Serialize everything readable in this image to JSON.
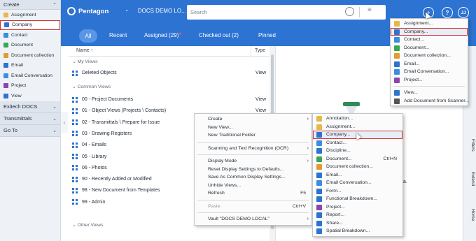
{
  "nav": {
    "create_label": "Create",
    "items": [
      {
        "label": "Assignment",
        "color": "#e6b84a"
      },
      {
        "label": "Company",
        "color": "#2d73d2"
      },
      {
        "label": "Contact",
        "color": "#3b8de0"
      },
      {
        "label": "Document",
        "color": "#36a852"
      },
      {
        "label": "Document collection",
        "color": "#e39b2d"
      },
      {
        "label": "Email",
        "color": "#2d73d2"
      },
      {
        "label": "Email Conversation",
        "color": "#3b8de0"
      },
      {
        "label": "Project",
        "color": "#8e44ad"
      },
      {
        "label": "View",
        "color": "#2d73d2"
      }
    ],
    "sections": [
      "Exitech DOCS",
      "Transmittals",
      "Go To"
    ]
  },
  "topbar": {
    "app_name": "Pentagon",
    "vault_name": "DOCS DEMO LO...",
    "search_placeholder": "Search",
    "help_glyph": "?",
    "user_glyph": "JJ"
  },
  "tabs": [
    "All",
    "Recent",
    "Assigned (29)",
    "Checked out (2)",
    "Pinned"
  ],
  "list": {
    "col_name": "Name",
    "col_type": "Type",
    "groups": [
      "My Views",
      "Common Views",
      "Other Views"
    ],
    "my_views": [
      {
        "name": "Deleted Objects",
        "type": "View"
      }
    ],
    "common_views": [
      {
        "name": "00 - Project Documents",
        "type": "View"
      },
      {
        "name": "01 - Object Views (Projects \\ Contacts)",
        "type": "View"
      },
      {
        "name": "02 - Transmittals \\ Prepare for Issue",
        "type": ""
      },
      {
        "name": "03 - Drawing Registers",
        "type": ""
      },
      {
        "name": "04 - Emails",
        "type": ""
      },
      {
        "name": "05 - Library",
        "type": ""
      },
      {
        "name": "06 - Photos",
        "type": ""
      },
      {
        "name": "90 - Recently Added or Modified",
        "type": ""
      },
      {
        "name": "98 - New Document from Templates",
        "type": ""
      },
      {
        "name": "99 - Admin",
        "type": ""
      }
    ]
  },
  "right_pane": {
    "partial_text": "ata."
  },
  "side_tabs": [
    "Filters",
    "Extend",
    "Home"
  ],
  "context_menu": [
    {
      "label": "Create",
      "arrow": true
    },
    {
      "label": "New View..."
    },
    {
      "label": "New Traditional Folder"
    },
    {
      "sep": true
    },
    {
      "label": "Scanning and Text Recognition (OCR)",
      "arrow": true
    },
    {
      "sep": true
    },
    {
      "label": "Display Mode",
      "arrow": true
    },
    {
      "label": "Reset Display Settings to Defaults..."
    },
    {
      "label": "Save As Common Display Settings..."
    },
    {
      "label": "Unhide Views..."
    },
    {
      "label": "Refresh",
      "shortcut": "F5"
    },
    {
      "sep": true
    },
    {
      "label": "Paste",
      "shortcut": "Ctrl+V",
      "disabled": true
    },
    {
      "sep": true
    },
    {
      "label": "Vault \"DOCS DEMO LOCAL\"",
      "arrow": true
    }
  ],
  "create_submenu": [
    {
      "label": "Annotation...",
      "color": "#e6b84a"
    },
    {
      "label": "Assignment...",
      "color": "#e6b84a"
    },
    {
      "label": "Company...",
      "color": "#2d73d2",
      "hl": true
    },
    {
      "label": "Contact...",
      "color": "#3b8de0"
    },
    {
      "label": "Discipline...",
      "color": "#2d73d2"
    },
    {
      "label": "Document...",
      "color": "#36a852",
      "shortcut": "Ctrl+N"
    },
    {
      "label": "Document collection...",
      "color": "#e39b2d"
    },
    {
      "label": "Email...",
      "color": "#2d73d2"
    },
    {
      "label": "Email Conversation...",
      "color": "#3b8de0"
    },
    {
      "label": "Form...",
      "color": "#2d73d2"
    },
    {
      "label": "Functional Breakdown...",
      "color": "#2d73d2"
    },
    {
      "label": "Project...",
      "color": "#8e44ad"
    },
    {
      "label": "Report...",
      "color": "#2d73d2"
    },
    {
      "label": "Share...",
      "color": "#2d73d2"
    },
    {
      "label": "Spatial Breakdown...",
      "color": "#2d73d2"
    }
  ],
  "top_dropdown": [
    {
      "label": "Assignment...",
      "color": "#e6b84a"
    },
    {
      "label": "Company...",
      "color": "#2d73d2",
      "hl": true
    },
    {
      "label": "Contact...",
      "color": "#3b8de0"
    },
    {
      "label": "Document...",
      "color": "#36a852"
    },
    {
      "label": "Document collection...",
      "color": "#e39b2d"
    },
    {
      "label": "Email...",
      "color": "#2d73d2"
    },
    {
      "label": "Email Conversation...",
      "color": "#3b8de0"
    },
    {
      "label": "Project...",
      "color": "#8e44ad"
    },
    {
      "sep": true
    },
    {
      "label": "View...",
      "color": "#2d73d2"
    },
    {
      "label": "Add Document from Scanner...",
      "color": "#555555"
    }
  ]
}
